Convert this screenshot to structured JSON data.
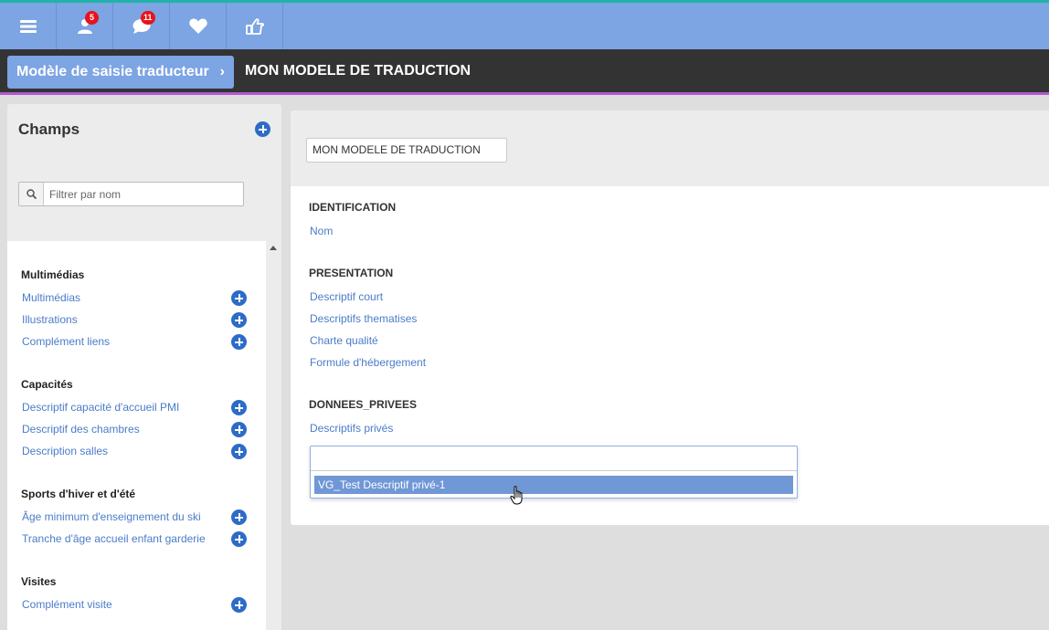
{
  "toolbar": {
    "badges": {
      "contacts": "5",
      "messages": "11"
    },
    "icons": [
      "menu-icon",
      "user-icon",
      "chat-icon",
      "heart-icon",
      "thumb-pointer-icon"
    ],
    "colors": {
      "bar": "#7da4e3",
      "accent_top": "#20b3a8",
      "badge": "#e8121b"
    }
  },
  "breadcrumb": {
    "label": "Modèle de saisie traducteur",
    "chevron": "›"
  },
  "page_title": "MON MODELE DE TRADUCTION",
  "left": {
    "title": "Champs",
    "search_placeholder": "Filtrer par nom",
    "groups": [
      {
        "title": "Multimédias",
        "items": [
          "Multimédias",
          "Illustrations",
          "Complément liens"
        ]
      },
      {
        "title": "Capacités",
        "items": [
          "Descriptif capacité d'accueil PMI",
          "Descriptif des chambres",
          "Description salles"
        ]
      },
      {
        "title": "Sports d'hiver et d'été",
        "items": [
          "Âge minimum d'enseignement du ski",
          "Tranche d'âge accueil enfant garderie"
        ]
      },
      {
        "title": "Visites",
        "items": [
          "Complément visite"
        ]
      }
    ]
  },
  "main": {
    "name_value": "MON MODELE DE TRADUCTION",
    "sections": [
      {
        "title": "IDENTIFICATION",
        "fields": [
          "Nom"
        ]
      },
      {
        "title": "PRESENTATION",
        "fields": [
          "Descriptif court",
          "Descriptifs thematises",
          "Charte qualité",
          "Formule d'hébergement"
        ]
      },
      {
        "title": "DONNEES_PRIVEES",
        "fields": [
          "Descriptifs privés"
        ]
      }
    ],
    "dropdown": {
      "value": "",
      "option": "VG_Test Descriptif privé-1"
    }
  }
}
